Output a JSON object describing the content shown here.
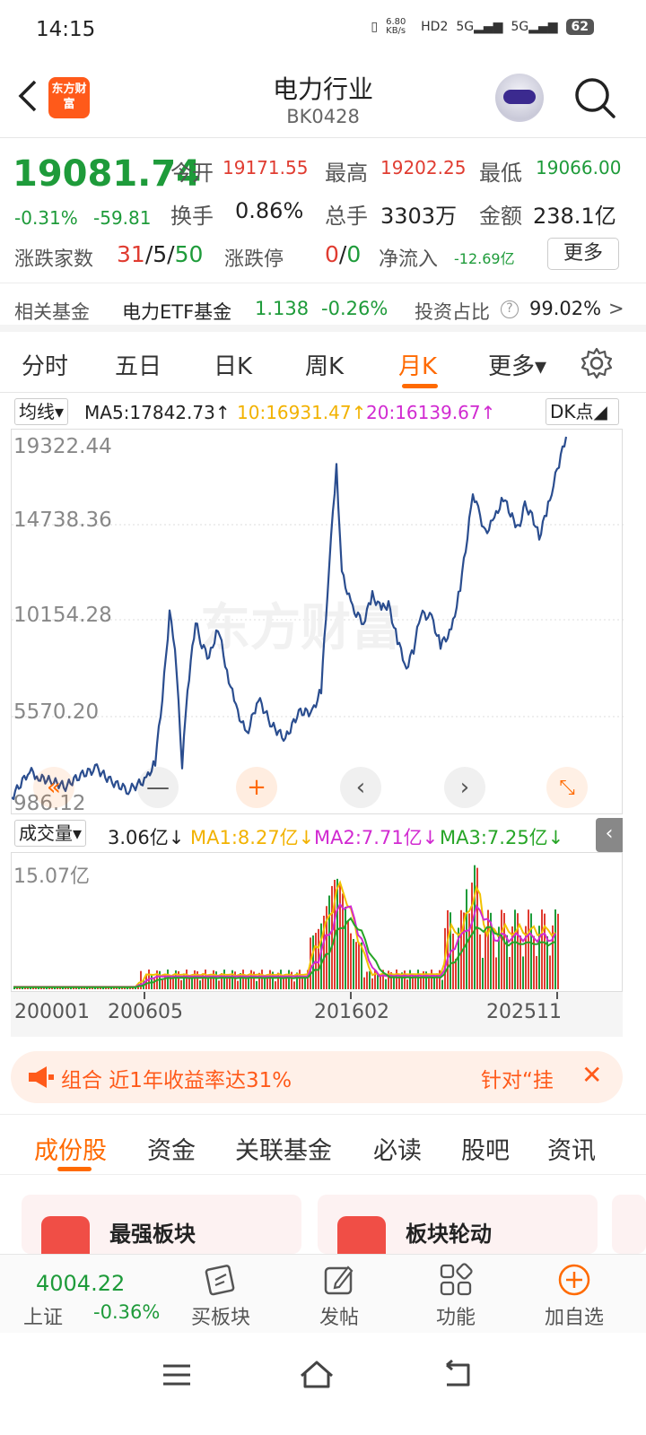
{
  "status_bar": {
    "time": "14:15",
    "net_speed": "6.80 KB/s",
    "hd": "HD2",
    "signal1": "5G",
    "signal2": "5G",
    "battery": "62"
  },
  "header": {
    "logo_text": "东方财富",
    "title": "电力行业",
    "code": "BK0428"
  },
  "quote": {
    "price": "19081.74",
    "change_pct": "-0.31%",
    "change_abs": "-59.81",
    "open_label": "今开",
    "open": "19171.55",
    "high_label": "最高",
    "high": "19202.25",
    "low_label": "最低",
    "low": "19066.00",
    "turnover_label": "换手",
    "turnover": "0.86%",
    "volume_label": "总手",
    "volume": "3303万",
    "amount_label": "金额",
    "amount": "238.1亿",
    "breadth_label": "涨跌家数",
    "up_count": "31",
    "flat_count": "5",
    "down_count": "50",
    "sep": "/",
    "limit_label": "涨跌停",
    "limit_up": "0",
    "limit_down": "0",
    "netflow_label": "净流入",
    "netflow": "-12.69亿",
    "more_label": "更多"
  },
  "fund": {
    "label": "相关基金",
    "name": "电力ETF基金",
    "price": "1.138",
    "change": "-0.26%",
    "ratio_label": "投资占比",
    "ratio": "99.02%",
    "arrow": ">"
  },
  "period_tabs": [
    {
      "label": "分时"
    },
    {
      "label": "五日"
    },
    {
      "label": "日K"
    },
    {
      "label": "周K"
    },
    {
      "label": "月K"
    },
    {
      "label": "更多▾"
    }
  ],
  "ma": {
    "select": "均线▾",
    "ma5": "MA5:17842.73↑",
    "ma10": "10:16931.47↑",
    "ma20": "20:16139.67↑",
    "dk": "DK点◢"
  },
  "price_axis": [
    "19322.44",
    "14738.36",
    "10154.28",
    "5570.20",
    "986.12"
  ],
  "watermark": "东方财富",
  "volume": {
    "select": "成交量▾",
    "value": "3.06亿↓",
    "ma1": "MA1:8.27亿↓",
    "ma2": "MA2:7.71亿↓",
    "ma3": "MA3:7.25亿↓",
    "axis_max": "15.07亿"
  },
  "x_axis": [
    "200001",
    "200605",
    "201602",
    "202511"
  ],
  "colors": {
    "up": "#e03c31",
    "down": "#1e9b3a",
    "accent": "#ff6a00",
    "line": "#2a4d8f",
    "ma1": "#f2c200",
    "ma2": "#d12ad1",
    "ma3": "#27a527"
  },
  "promo": {
    "text": "组合 近1年收益率达31%",
    "right": "针对“挂",
    "close": "✕"
  },
  "section_tabs": [
    "成份股",
    "资金",
    "关联基金",
    "必读",
    "股吧",
    "资讯"
  ],
  "cards": [
    {
      "title": "最强板块"
    },
    {
      "title": "板块轮动"
    }
  ],
  "toolbar": {
    "index_value": "4004.22",
    "index_name": "上证",
    "index_change": "-0.36%",
    "buy_label": "买板块",
    "post_label": "发帖",
    "func_label": "功能",
    "add_label": "加自选"
  }
}
